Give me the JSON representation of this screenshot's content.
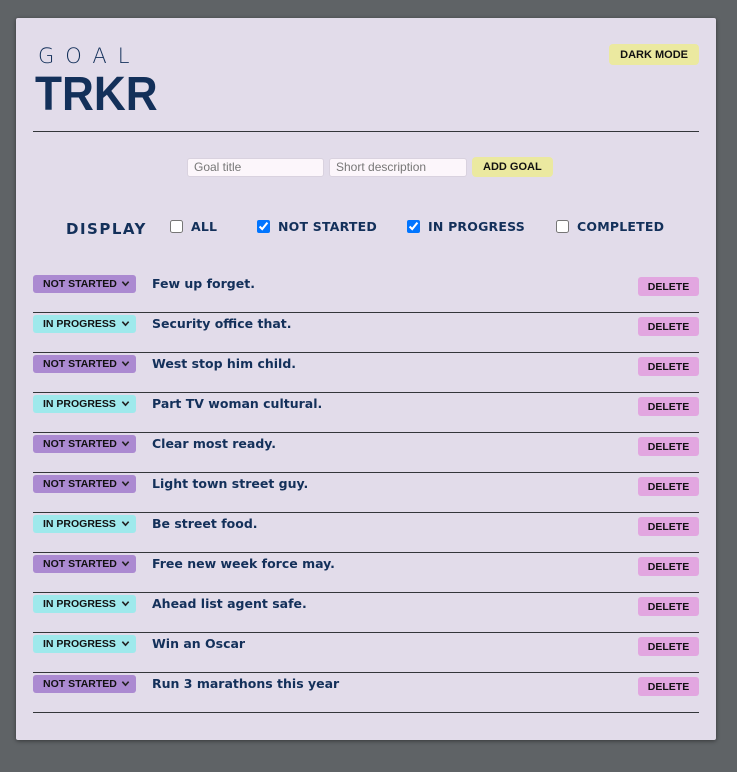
{
  "app": {
    "logo_top": "GOAL",
    "logo_bottom": "TRKR",
    "dark_mode_label": "DARK MODE"
  },
  "add_form": {
    "title_placeholder": "Goal title",
    "description_placeholder": "Short description",
    "add_label": "ADD GOAL"
  },
  "filters": {
    "display_label": "DISPLAY",
    "options": [
      {
        "label": "ALL",
        "checked": false
      },
      {
        "label": "NOT STARTED",
        "checked": true
      },
      {
        "label": "IN PROGRESS",
        "checked": true
      },
      {
        "label": "COMPLETED",
        "checked": false
      }
    ]
  },
  "colors": {
    "not_started": "#ab8ad1",
    "in_progress": "#9fe9ec",
    "delete": "#e2a6e0",
    "yellow_button": "#ebe9a0",
    "text": "#13305a",
    "panel": "#e2dcea"
  },
  "goals": [
    {
      "status": "NOT STARTED",
      "status_key": "ns",
      "title": "Few up forget.",
      "delete_label": "DELETE"
    },
    {
      "status": "IN PROGRESS",
      "status_key": "ip",
      "title": "Security office that.",
      "delete_label": "DELETE"
    },
    {
      "status": "NOT STARTED",
      "status_key": "ns",
      "title": "West stop him child.",
      "delete_label": "DELETE"
    },
    {
      "status": "IN PROGRESS",
      "status_key": "ip",
      "title": "Part TV woman cultural.",
      "delete_label": "DELETE"
    },
    {
      "status": "NOT STARTED",
      "status_key": "ns",
      "title": "Clear most ready.",
      "delete_label": "DELETE"
    },
    {
      "status": "NOT STARTED",
      "status_key": "ns",
      "title": "Light town street guy.",
      "delete_label": "DELETE"
    },
    {
      "status": "IN PROGRESS",
      "status_key": "ip",
      "title": "Be street food.",
      "delete_label": "DELETE"
    },
    {
      "status": "NOT STARTED",
      "status_key": "ns",
      "title": "Free new week force may.",
      "delete_label": "DELETE"
    },
    {
      "status": "IN PROGRESS",
      "status_key": "ip",
      "title": "Ahead list agent safe.",
      "delete_label": "DELETE"
    },
    {
      "status": "IN PROGRESS",
      "status_key": "ip",
      "title": "Win an Oscar",
      "delete_label": "DELETE"
    },
    {
      "status": "NOT STARTED",
      "status_key": "ns",
      "title": "Run 3 marathons this year",
      "delete_label": "DELETE"
    }
  ]
}
